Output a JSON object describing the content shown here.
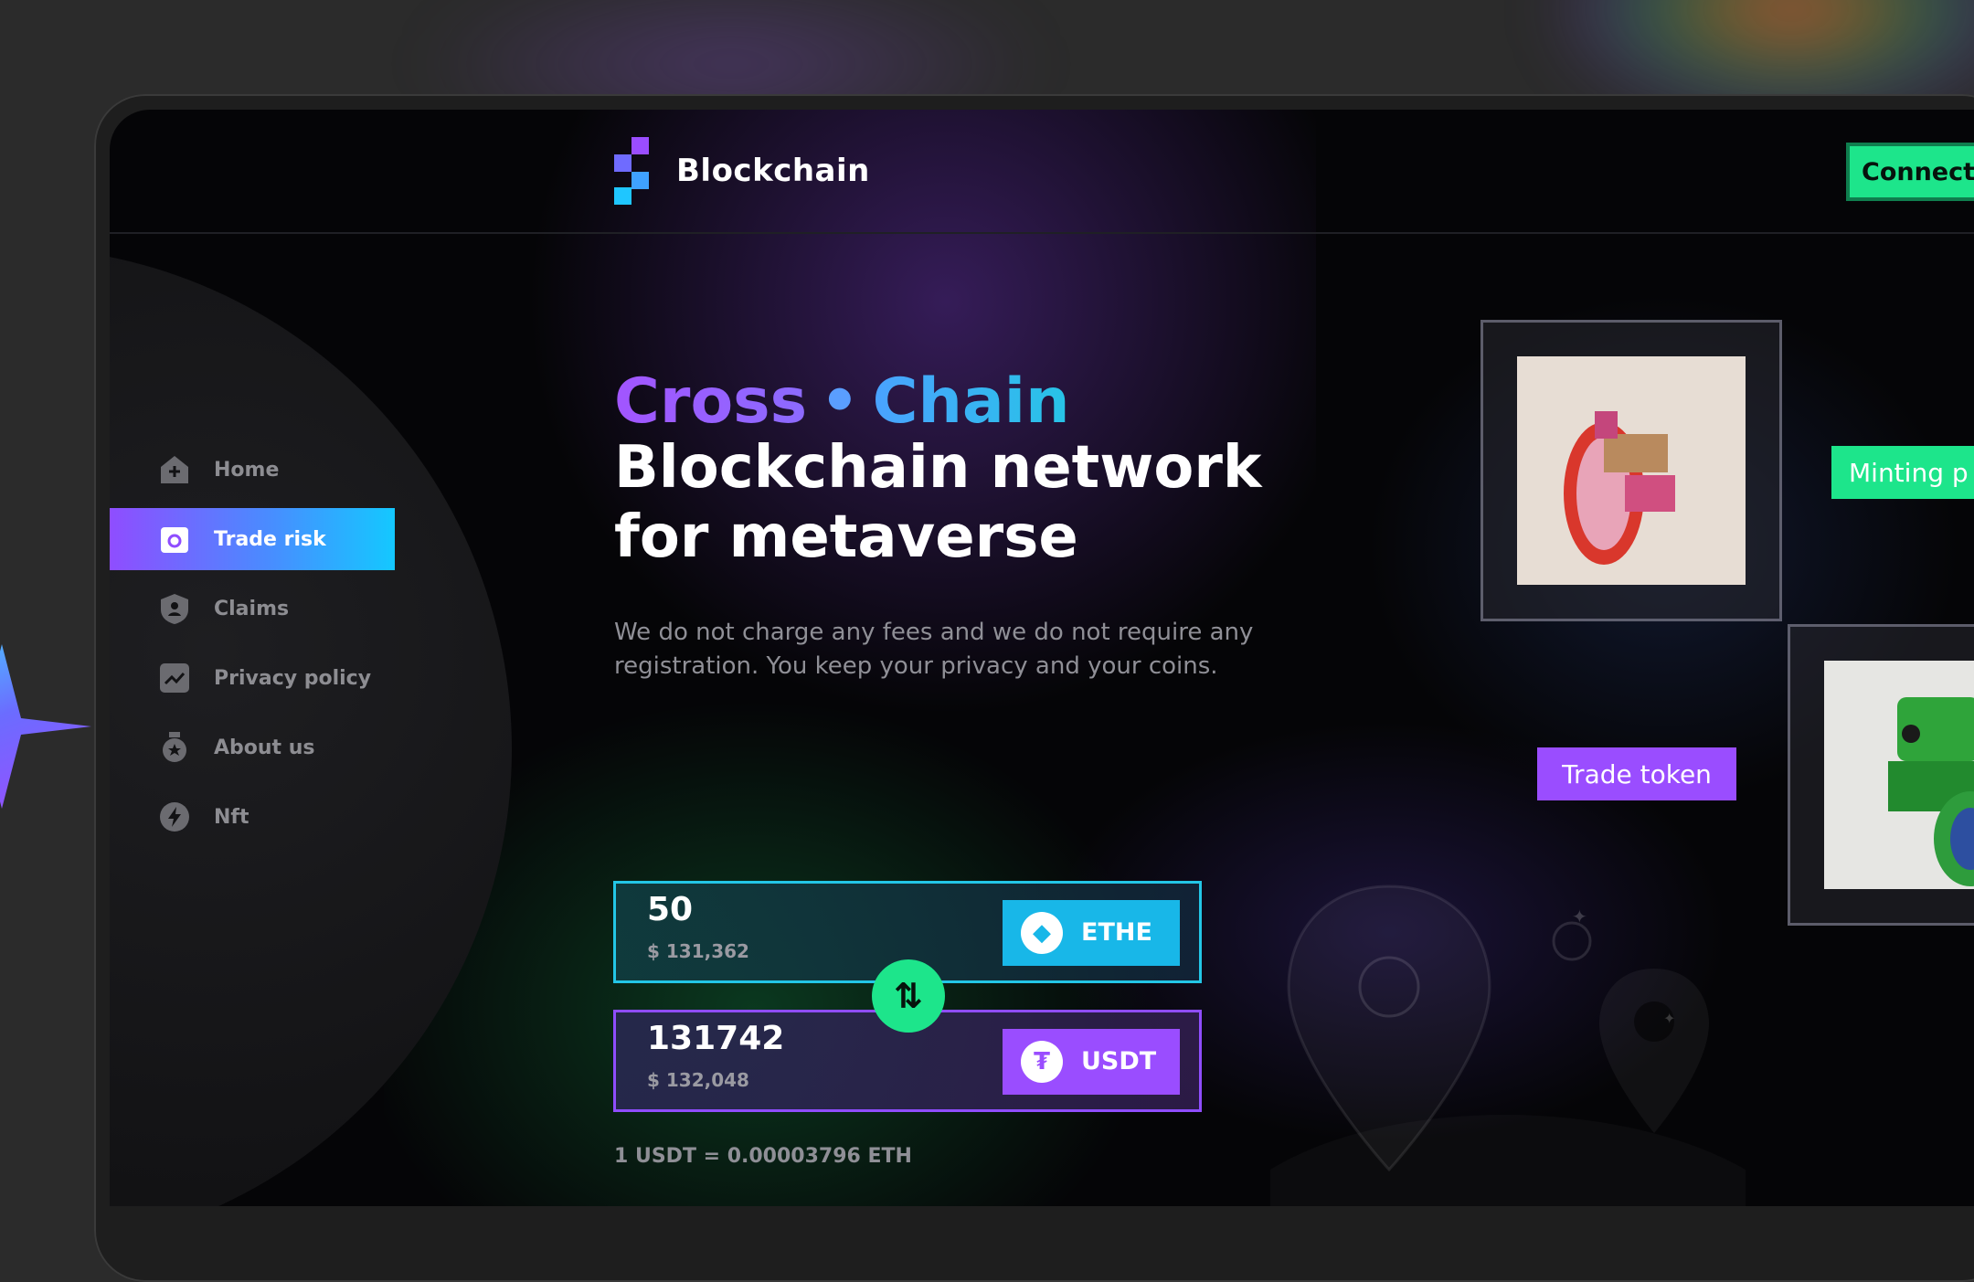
{
  "app": {
    "brand": "Blockchain",
    "connect_label": "Connect"
  },
  "colors": {
    "accent_green": "#1de58b",
    "accent_purple": "#9a4dff",
    "accent_cyan": "#18b7e8",
    "background": "#050507"
  },
  "sidebar": {
    "items": [
      {
        "label": "Home",
        "icon": "home-icon",
        "active": false
      },
      {
        "label": "Trade risk",
        "icon": "wallet-icon",
        "active": true
      },
      {
        "label": "Claims",
        "icon": "shield-user-icon",
        "active": false
      },
      {
        "label": "Privacy policy",
        "icon": "chart-icon",
        "active": false
      },
      {
        "label": "About us",
        "icon": "badge-icon",
        "active": false
      },
      {
        "label": "Nft",
        "icon": "lightning-icon",
        "active": false
      }
    ]
  },
  "hero": {
    "title_word1": "Cross",
    "title_separator": "•",
    "title_word2": "Chain",
    "title_line2": "Blockchain network for metaverse",
    "description": "We do not charge any fees and we do not require any registration. You keep your privacy and your coins."
  },
  "swap": {
    "from": {
      "amount": "50",
      "usd": "$ 131,362",
      "token": "ETHE",
      "icon": "ethereum-icon"
    },
    "to": {
      "amount": "131742",
      "usd": "$ 132,048",
      "token": "USDT",
      "icon": "tether-icon"
    },
    "toggle_icon": "swap-arrows-icon",
    "rate": "1 USDT = 0.00003796 ETH"
  },
  "nft": {
    "minting_label": "Minting p",
    "trade_label": "Trade token"
  }
}
